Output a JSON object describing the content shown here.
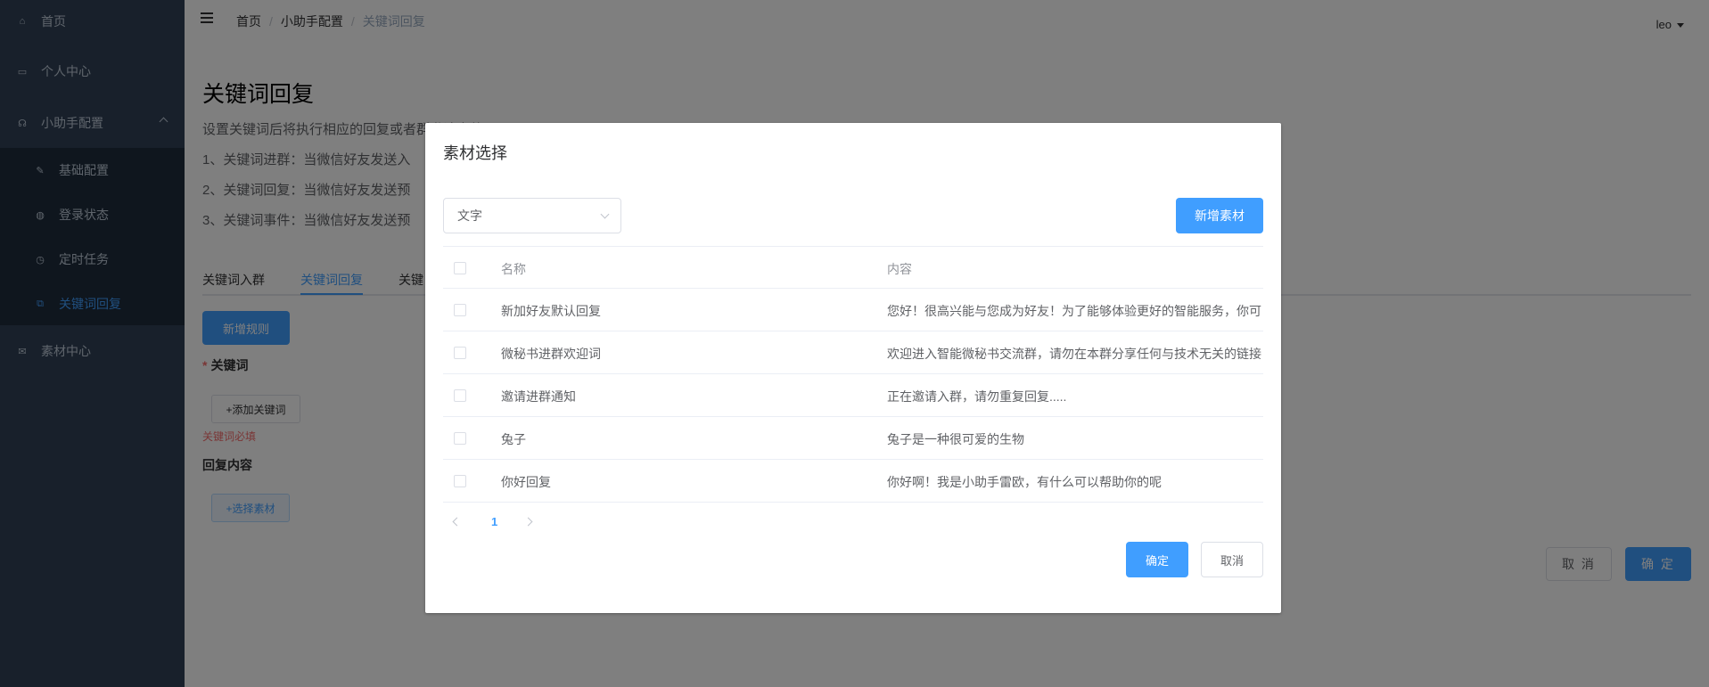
{
  "sidebar": {
    "items": [
      {
        "label": "首页",
        "icon": "home-icon"
      },
      {
        "label": "个人中心",
        "icon": "user-card-icon"
      },
      {
        "label": "小助手配置",
        "icon": "headset-icon"
      },
      {
        "label": "素材中心",
        "icon": "mail-icon"
      }
    ],
    "sub_items": [
      {
        "label": "基础配置",
        "icon": "edit-icon"
      },
      {
        "label": "登录状态",
        "icon": "globe-icon"
      },
      {
        "label": "定时任务",
        "icon": "clock-icon"
      },
      {
        "label": "关键词回复",
        "icon": "reply-icon",
        "active": true
      }
    ]
  },
  "header": {
    "breadcrumb": [
      "首页",
      "小助手配置",
      "关键词回复"
    ],
    "user": "leo"
  },
  "page": {
    "title": "关键词回复",
    "desc_lines": [
      "设置关键词后将执行相应的回复或者群邀请事件",
      "1、关键词进群：当微信好友发送入",
      "2、关键词回复：当微信好友发送预",
      "3、关键词事件：当微信好友发送预"
    ],
    "tabs": [
      "关键词入群",
      "关键词回复",
      "关键"
    ],
    "new_rule_button": "新增规则",
    "keyword_label": "关键词",
    "add_keyword_button": "+添加关键词",
    "keyword_error": "关键词必填",
    "reply_label": "回复内容",
    "select_material_button": "+选择素材",
    "cancel_button": "取 消",
    "ok_button": "确 定"
  },
  "dialog": {
    "title": "素材选择",
    "select_value": "文字",
    "add_material_button": "新增素材",
    "columns": {
      "name": "名称",
      "content": "内容"
    },
    "rows": [
      {
        "name": "新加好友默认回复",
        "content": "您好！很高兴能与您成为好友！为了能够体验更好的智能服务，你可"
      },
      {
        "name": "微秘书进群欢迎词",
        "content": "欢迎进入智能微秘书交流群，请勿在本群分享任何与技术无关的链接"
      },
      {
        "name": "邀请进群通知",
        "content": "正在邀请入群，请勿重复回复....."
      },
      {
        "name": "兔子",
        "content": "兔子是一种很可爱的生物"
      },
      {
        "name": "你好回复",
        "content": "你好啊！我是小助手雷欧，有什么可以帮助你的呢"
      }
    ],
    "current_page": "1",
    "ok_button": "确定",
    "cancel_button": "取消"
  },
  "colors": {
    "sidebar_bg": "#304156",
    "submenu_bg": "#1f2d3d",
    "accent": "#409eff",
    "error": "#f56c6c"
  }
}
